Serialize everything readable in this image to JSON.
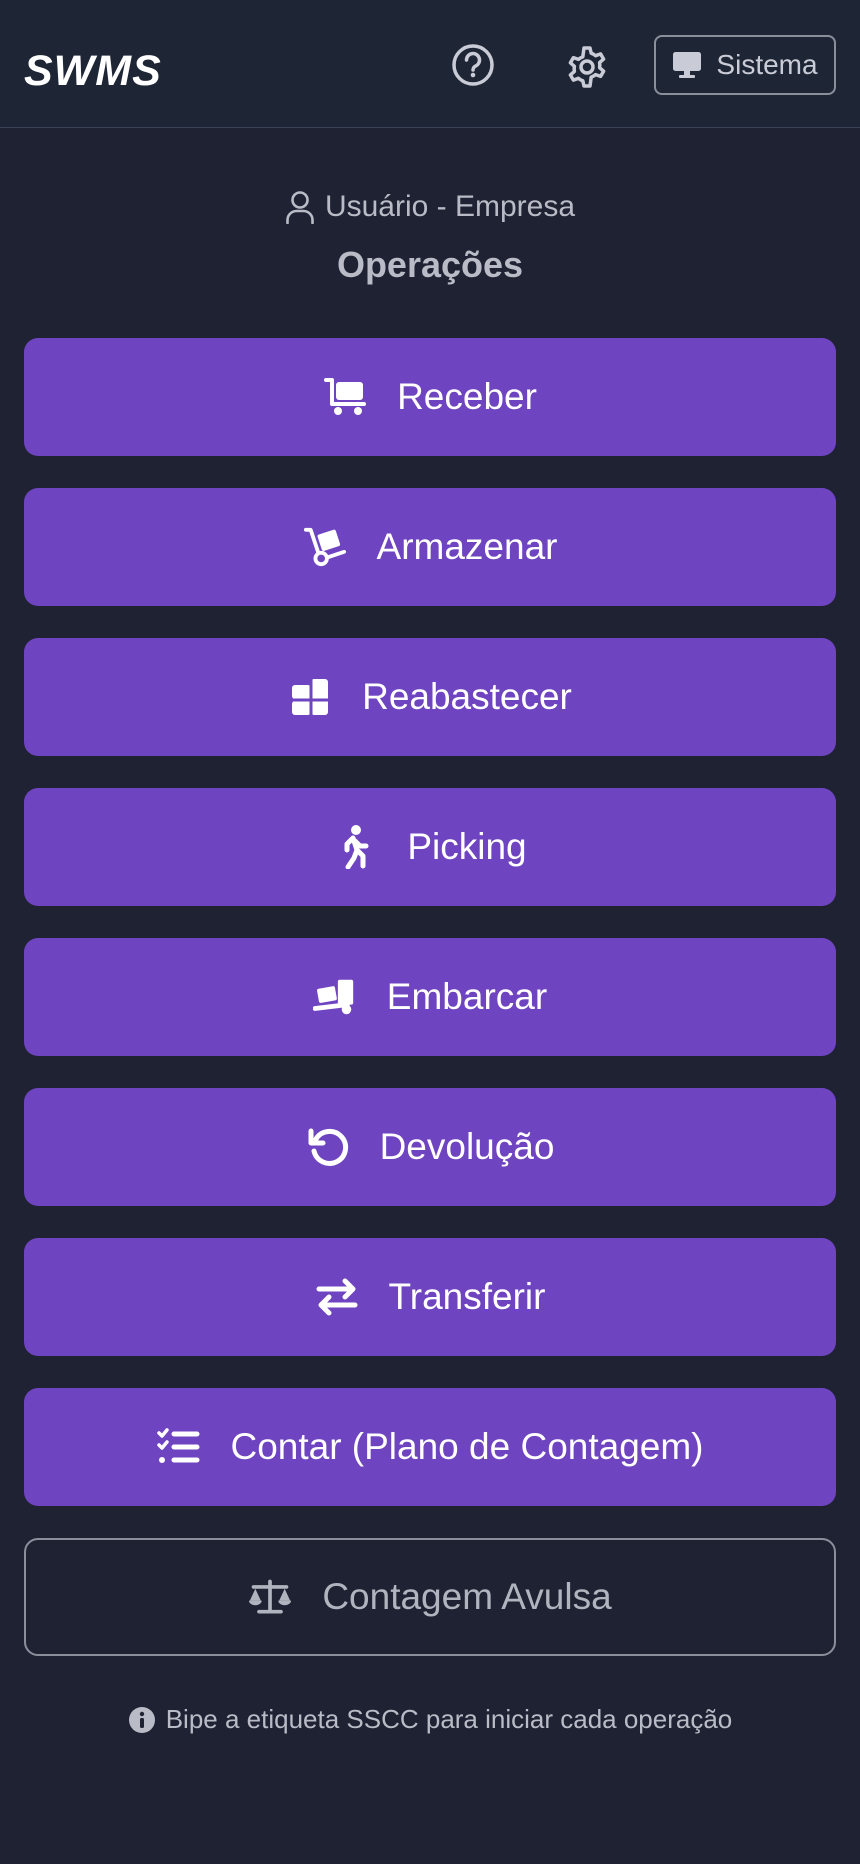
{
  "header": {
    "logo_text": "SWMS",
    "help_icon": "question-circle-icon",
    "settings_icon": "gear-icon",
    "system_button": {
      "icon": "monitor-icon",
      "label": "Sistema"
    }
  },
  "user": {
    "icon": "user-icon",
    "label": "Usuário - Empresa"
  },
  "section_title": "Operações",
  "operations": [
    {
      "label": "Receber",
      "icon": "cart-flatbed-icon"
    },
    {
      "label": "Armazenar",
      "icon": "hand-truck-icon"
    },
    {
      "label": "Reabastecer",
      "icon": "stacked-boxes-icon"
    },
    {
      "label": "Picking",
      "icon": "walking-person-icon"
    },
    {
      "label": "Embarcar",
      "icon": "truck-loading-icon"
    },
    {
      "label": "Devolução",
      "icon": "undo-icon"
    },
    {
      "label": "Transferir",
      "icon": "transfer-arrows-icon"
    },
    {
      "label": "Contar (Plano de Contagem)",
      "icon": "checklist-icon"
    }
  ],
  "secondary_operation": {
    "label": "Contagem Avulsa",
    "icon": "scale-icon"
  },
  "hint": {
    "icon": "info-icon",
    "text": "Bipe a etiqueta SSCC para iniciar cada operação"
  },
  "colors": {
    "background": "#1f2233",
    "header": "#1e2535",
    "primary": "#6f44c0",
    "text_muted": "#b9bcc6"
  }
}
